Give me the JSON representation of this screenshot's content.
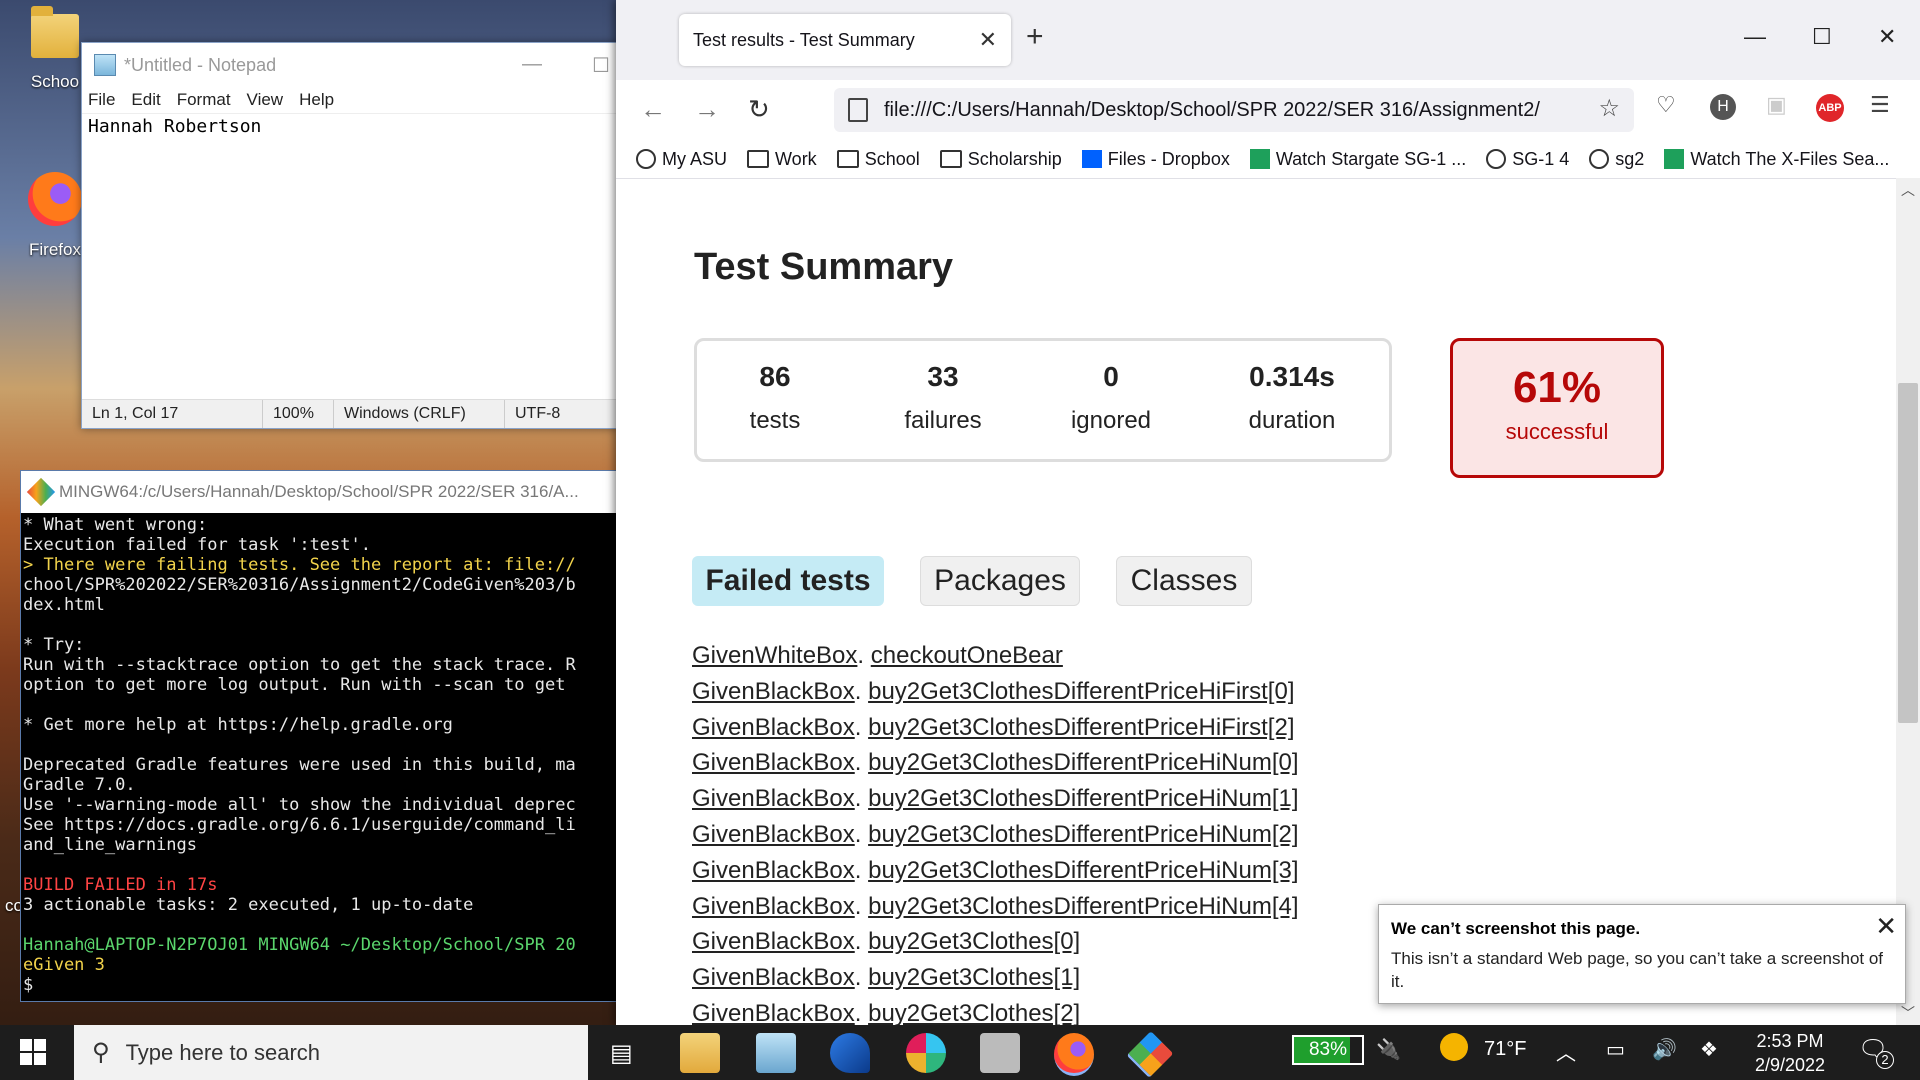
{
  "desktop": {
    "icons": [
      {
        "label": "Schoo"
      },
      {
        "label": "Firefox"
      },
      {
        "label": "co"
      }
    ]
  },
  "notepad": {
    "title": "*Untitled - Notepad",
    "menu": [
      "File",
      "Edit",
      "Format",
      "View",
      "Help"
    ],
    "content": "Hannah Robertson",
    "status": {
      "position": "Ln 1, Col 17",
      "zoom": "100%",
      "line_endings": "Windows (CRLF)",
      "encoding": "UTF-8"
    }
  },
  "terminal": {
    "title": "MINGW64:/c/Users/Hannah/Desktop/School/SPR 2022/SER 316/A...",
    "lines": [
      "* What went wrong:",
      "Execution failed for task ':test'.",
      "> There were failing tests. See the report at: file://",
      "chool/SPR%202022/SER%20316/Assignment2/CodeGiven%203/b",
      "dex.html",
      "",
      "* Try:",
      "Run with --stacktrace option to get the stack trace. R",
      "option to get more log output. Run with --scan to get",
      "",
      "* Get more help at https://help.gradle.org",
      "",
      "Deprecated Gradle features were used in this build, ma",
      "Gradle 7.0.",
      "Use '--warning-mode all' to show the individual deprec",
      "See https://docs.gradle.org/6.6.1/userguide/command_li",
      "and_line_warnings",
      "",
      "BUILD FAILED in 17s",
      "3 actionable tasks: 2 executed, 1 up-to-date",
      "",
      "Hannah@LAPTOP-N2P7OJ01 MINGW64 ~/Desktop/School/SPR 20",
      "eGiven 3",
      "$ "
    ]
  },
  "browser": {
    "tab_title": "Test results - Test Summary",
    "url": "file:///C:/Users/Hannah/Desktop/School/SPR 2022/SER 316/Assignment2/",
    "profile_letter": "H",
    "abp_label": "ABP",
    "bookmarks": [
      {
        "label": "My ASU",
        "icon": "globe-icon"
      },
      {
        "label": "Work",
        "icon": "folder-icon"
      },
      {
        "label": "School",
        "icon": "folder-icon"
      },
      {
        "label": "Scholarship",
        "icon": "folder-icon"
      },
      {
        "label": "Files - Dropbox",
        "icon": "dropbox-icon"
      },
      {
        "label": "Watch Stargate SG-1 ...",
        "icon": "video-icon"
      },
      {
        "label": "SG-1 4",
        "icon": "globe-icon"
      },
      {
        "label": "sg2",
        "icon": "globe-icon"
      },
      {
        "label": "Watch The X-Files Sea...",
        "icon": "video-icon"
      }
    ]
  },
  "report": {
    "title": "Test Summary",
    "stats": {
      "tests": {
        "value": "86",
        "label": "tests"
      },
      "failures": {
        "value": "33",
        "label": "failures"
      },
      "ignored": {
        "value": "0",
        "label": "ignored"
      },
      "duration": {
        "value": "0.314s",
        "label": "duration"
      }
    },
    "success": {
      "value": "61%",
      "label": "successful"
    },
    "tabs": [
      "Failed tests",
      "Packages",
      "Classes"
    ],
    "failed_tests": [
      {
        "cls": "GivenWhiteBox",
        "method": "checkoutOneBear"
      },
      {
        "cls": "GivenBlackBox",
        "method": "buy2Get3ClothesDifferentPriceHiFirst[0]"
      },
      {
        "cls": "GivenBlackBox",
        "method": "buy2Get3ClothesDifferentPriceHiFirst[2]"
      },
      {
        "cls": "GivenBlackBox",
        "method": "buy2Get3ClothesDifferentPriceHiNum[0]"
      },
      {
        "cls": "GivenBlackBox",
        "method": "buy2Get3ClothesDifferentPriceHiNum[1]"
      },
      {
        "cls": "GivenBlackBox",
        "method": "buy2Get3ClothesDifferentPriceHiNum[2]"
      },
      {
        "cls": "GivenBlackBox",
        "method": "buy2Get3ClothesDifferentPriceHiNum[3]"
      },
      {
        "cls": "GivenBlackBox",
        "method": "buy2Get3ClothesDifferentPriceHiNum[4]"
      },
      {
        "cls": "GivenBlackBox",
        "method": "buy2Get3Clothes[0]"
      },
      {
        "cls": "GivenBlackBox",
        "method": "buy2Get3Clothes[1]"
      },
      {
        "cls": "GivenBlackBox",
        "method": "buy2Get3Clothes[2]"
      }
    ]
  },
  "toast": {
    "title": "We can’t screenshot this page.",
    "body": "This isn’t a standard Web page, so you can’t take a screenshot of it."
  },
  "taskbar": {
    "search_placeholder": "Type here to search",
    "battery": "83%",
    "battery_level": 0.83,
    "weather": "71°F",
    "time": "2:53 PM",
    "date": "2/9/2022",
    "notifications": "2"
  },
  "colors": {
    "fail_red": "#b60808",
    "fail_bg": "#fbe5e5",
    "tab_active_bg": "#c5ebf5"
  }
}
